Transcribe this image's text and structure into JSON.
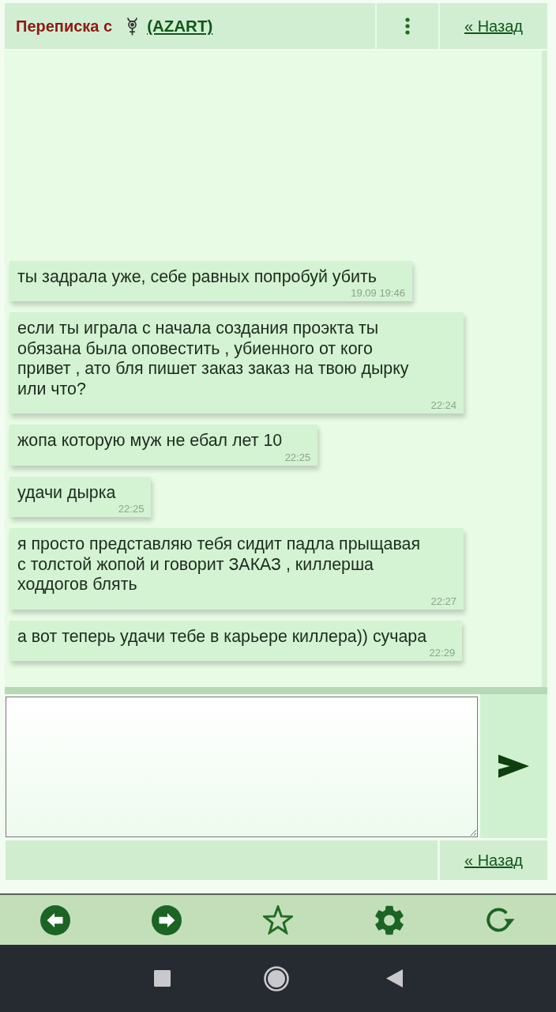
{
  "header": {
    "title": "Переписка с",
    "contact": "(AZART)",
    "back_link": "« Назад"
  },
  "messages": [
    {
      "text": "ты задрала уже, себе равных попробуй убить",
      "time": "19.09 19:46"
    },
    {
      "text": "если ты играла с начала создания проэкта ты обязана была оповестить , убиенного от кого привет , ато бля пишет заказ заказ на твою дырку или что?",
      "time": "22:24"
    },
    {
      "text": "жопа которую муж не ебал лет 10",
      "time": "22:25"
    },
    {
      "text": "удачи дырка",
      "time": "22:25"
    },
    {
      "text": "я просто представляю тебя сидит падла прыщавая с толстой жопой и говорит ЗАКАЗ , киллерша ходдогов блять",
      "time": "22:27"
    },
    {
      "text": "а вот теперь удачи тебе в карьере киллера)) сучара",
      "time": "22:29"
    }
  ],
  "footer": {
    "back_link": "« Назад"
  }
}
